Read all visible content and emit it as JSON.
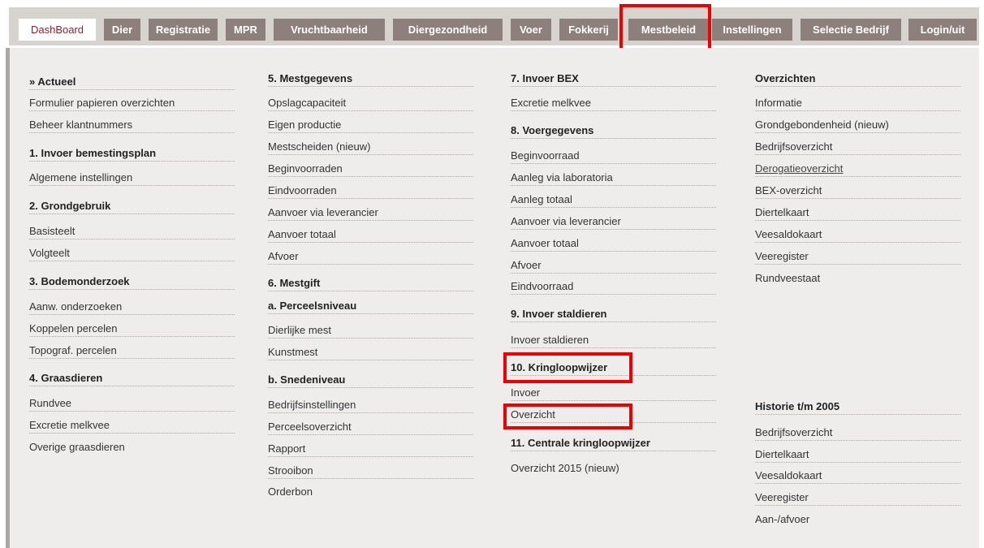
{
  "nav": {
    "tabs": [
      {
        "label": "DashBoard"
      },
      {
        "label": "Dier"
      },
      {
        "label": "Registratie"
      },
      {
        "label": "MPR"
      },
      {
        "label": "Vruchtbaarheid"
      },
      {
        "label": "Diergezondheid"
      },
      {
        "label": "Voer"
      },
      {
        "label": "Fokkerij"
      },
      {
        "label": "Mestbeleid"
      },
      {
        "label": "Instellingen"
      },
      {
        "label": "Selectie Bedrijf"
      },
      {
        "label": "Login/uit"
      }
    ]
  },
  "menu": {
    "col1": [
      {
        "label": "» Actueel"
      },
      {
        "label": "Formulier papieren overzichten"
      },
      {
        "label": "Beheer klantnummers"
      },
      {
        "label": "1. Invoer bemestingsplan"
      },
      {
        "label": "Algemene instellingen"
      },
      {
        "label": "2. Grondgebruik"
      },
      {
        "label": "Basisteelt"
      },
      {
        "label": "Volgteelt"
      },
      {
        "label": "3. Bodemonderzoek"
      },
      {
        "label": "Aanw. onderzoeken"
      },
      {
        "label": "Koppelen percelen"
      },
      {
        "label": "Topograf. percelen"
      },
      {
        "label": "4. Graasdieren"
      },
      {
        "label": "Rundvee"
      },
      {
        "label": "Excretie melkvee"
      },
      {
        "label": "Overige graasdieren"
      }
    ],
    "col2": [
      {
        "label": "5. Mestgegevens"
      },
      {
        "label": "Opslagcapaciteit"
      },
      {
        "label": "Eigen productie"
      },
      {
        "label": "Mestscheiden (nieuw)"
      },
      {
        "label": "Beginvoorraden"
      },
      {
        "label": "Eindvoorraden"
      },
      {
        "label": "Aanvoer via leverancier"
      },
      {
        "label": "Aanvoer totaal"
      },
      {
        "label": "Afvoer"
      },
      {
        "label": "6. Mestgift"
      },
      {
        "label": "a. Perceelsniveau"
      },
      {
        "label": "Dierlijke mest"
      },
      {
        "label": "Kunstmest"
      },
      {
        "label": "b. Snedeniveau"
      },
      {
        "label": "Bedrijfsinstellingen"
      },
      {
        "label": "Perceelsoverzicht"
      },
      {
        "label": "Rapport"
      },
      {
        "label": "Strooibon"
      },
      {
        "label": "Orderbon"
      }
    ],
    "col3": [
      {
        "label": "7. Invoer BEX"
      },
      {
        "label": "Excretie melkvee"
      },
      {
        "label": "8. Voergegevens"
      },
      {
        "label": "Beginvoorraad"
      },
      {
        "label": "Aanleg via laboratoria"
      },
      {
        "label": "Aanleg totaal"
      },
      {
        "label": "Aanvoer via leverancier"
      },
      {
        "label": "Aanvoer totaal"
      },
      {
        "label": "Afvoer"
      },
      {
        "label": "Eindvoorraad"
      },
      {
        "label": "9. Invoer staldieren"
      },
      {
        "label": "Invoer staldieren"
      },
      {
        "label": "10. Kringloopwijzer"
      },
      {
        "label": "Invoer"
      },
      {
        "label": "Overzicht"
      },
      {
        "label": "11. Centrale kringloopwijzer"
      },
      {
        "label": "Overzicht 2015 (nieuw)"
      }
    ],
    "col4": [
      {
        "label": "Overzichten"
      },
      {
        "label": "Informatie"
      },
      {
        "label": "Grondgebondenheid (nieuw)"
      },
      {
        "label": "Bedrijfsoverzicht"
      },
      {
        "label": "Derogatieoverzicht"
      },
      {
        "label": "BEX-overzicht"
      },
      {
        "label": "Diertelkaart"
      },
      {
        "label": "Veesaldokaart"
      },
      {
        "label": "Veeregister"
      },
      {
        "label": "Rundveestaat"
      },
      {
        "label": "Historie t/m 2005"
      },
      {
        "label": "Bedrijfsoverzicht"
      },
      {
        "label": "Diertelkaart"
      },
      {
        "label": "Veesaldokaart"
      },
      {
        "label": "Veeregister"
      },
      {
        "label": "Aan-/afvoer"
      }
    ]
  },
  "colors": {
    "tab_bg": "#8c7f7c",
    "active_tab_text": "#8a2433",
    "highlight": "#ee0000",
    "content_bg": "#eeedeb"
  }
}
